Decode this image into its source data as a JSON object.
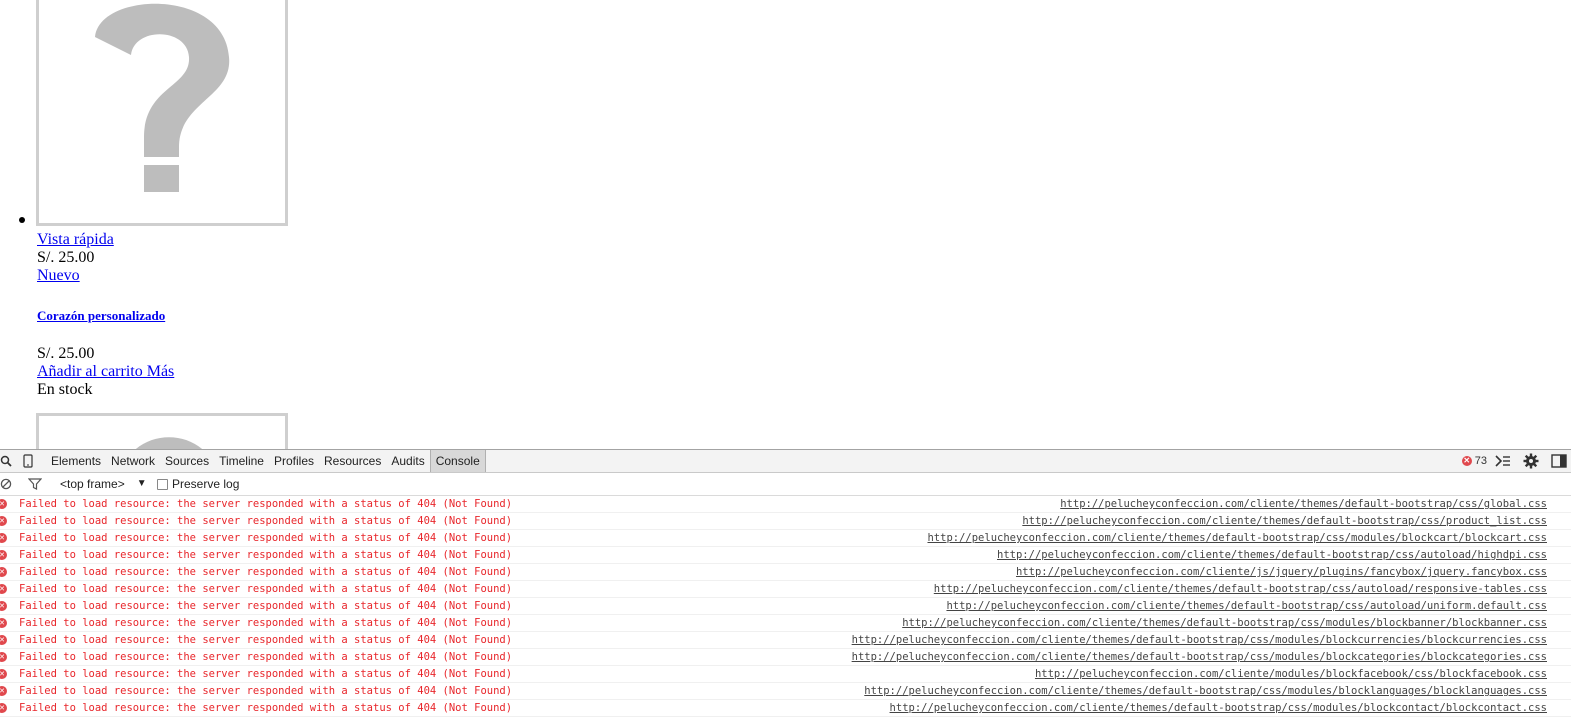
{
  "page": {
    "quick_view": "Vista rápida",
    "price_1": "S/. 25.00",
    "new_label": "Nuevo",
    "product_name": "Corazón personalizado",
    "price_2": "S/. 25.00",
    "add_to_cart": "Añadir al carrito Más",
    "stock": "En stock"
  },
  "devtools": {
    "tabs": [
      "Elements",
      "Network",
      "Sources",
      "Timeline",
      "Profiles",
      "Resources",
      "Audits",
      "Console"
    ],
    "active_tab": "Console",
    "error_count": "73",
    "frame": "<top frame>",
    "preserve_log": "Preserve log",
    "error_color": "#e8262b",
    "rows": [
      {
        "message": "Failed to load resource: the server responded with a status of 404 (Not Found)",
        "source": "http://pelucheyconfeccion.com/cliente/themes/default-bootstrap/css/global.css"
      },
      {
        "message": "Failed to load resource: the server responded with a status of 404 (Not Found)",
        "source": "http://pelucheyconfeccion.com/cliente/themes/default-bootstrap/css/product_list.css"
      },
      {
        "message": "Failed to load resource: the server responded with a status of 404 (Not Found)",
        "source": "http://pelucheyconfeccion.com/cliente/themes/default-bootstrap/css/modules/blockcart/blockcart.css"
      },
      {
        "message": "Failed to load resource: the server responded with a status of 404 (Not Found)",
        "source": "http://pelucheyconfeccion.com/cliente/themes/default-bootstrap/css/autoload/highdpi.css"
      },
      {
        "message": "Failed to load resource: the server responded with a status of 404 (Not Found)",
        "source": "http://pelucheyconfeccion.com/cliente/js/jquery/plugins/fancybox/jquery.fancybox.css"
      },
      {
        "message": "Failed to load resource: the server responded with a status of 404 (Not Found)",
        "source": "http://pelucheyconfeccion.com/cliente/themes/default-bootstrap/css/autoload/responsive-tables.css"
      },
      {
        "message": "Failed to load resource: the server responded with a status of 404 (Not Found)",
        "source": "http://pelucheyconfeccion.com/cliente/themes/default-bootstrap/css/autoload/uniform.default.css"
      },
      {
        "message": "Failed to load resource: the server responded with a status of 404 (Not Found)",
        "source": "http://pelucheyconfeccion.com/cliente/themes/default-bootstrap/css/modules/blockbanner/blockbanner.css"
      },
      {
        "message": "Failed to load resource: the server responded with a status of 404 (Not Found)",
        "source": "http://pelucheyconfeccion.com/cliente/themes/default-bootstrap/css/modules/blockcurrencies/blockcurrencies.css"
      },
      {
        "message": "Failed to load resource: the server responded with a status of 404 (Not Found)",
        "source": "http://pelucheyconfeccion.com/cliente/themes/default-bootstrap/css/modules/blockcategories/blockcategories.css"
      },
      {
        "message": "Failed to load resource: the server responded with a status of 404 (Not Found)",
        "source": "http://pelucheyconfeccion.com/cliente/modules/blockfacebook/css/blockfacebook.css"
      },
      {
        "message": "Failed to load resource: the server responded with a status of 404 (Not Found)",
        "source": "http://pelucheyconfeccion.com/cliente/themes/default-bootstrap/css/modules/blocklanguages/blocklanguages.css"
      },
      {
        "message": "Failed to load resource: the server responded with a status of 404 (Not Found)",
        "source": "http://pelucheyconfeccion.com/cliente/themes/default-bootstrap/css/modules/blockcontact/blockcontact.css"
      }
    ]
  }
}
